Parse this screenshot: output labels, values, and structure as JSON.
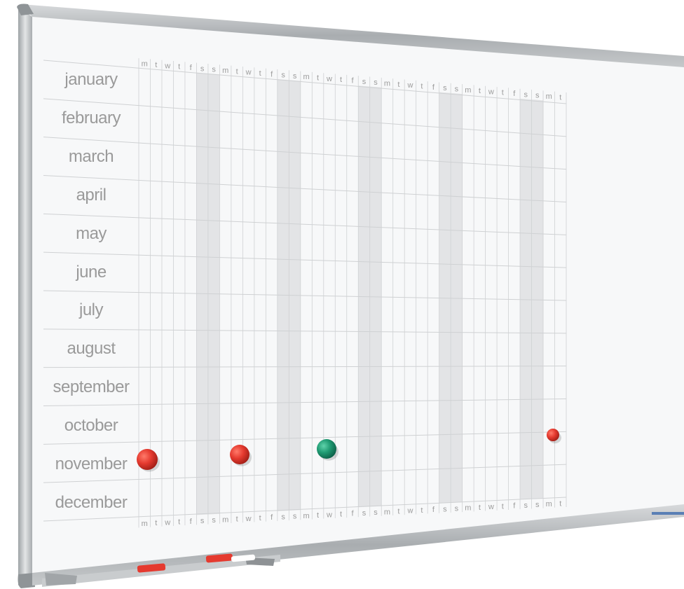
{
  "board": {
    "type": "year-planner whiteboard",
    "months": [
      "january",
      "february",
      "march",
      "april",
      "may",
      "june",
      "july",
      "august",
      "september",
      "october",
      "november",
      "december"
    ],
    "weekday_header": [
      "m",
      "t",
      "w",
      "t",
      "f",
      "s",
      "s",
      "m",
      "t",
      "w",
      "t",
      "f",
      "s",
      "s",
      "m",
      "t",
      "w",
      "t",
      "f",
      "s",
      "s",
      "m",
      "t",
      "w",
      "t",
      "f",
      "s",
      "s",
      "m",
      "t",
      "w",
      "t",
      "f",
      "s",
      "s",
      "m",
      "t"
    ],
    "magnets": [
      {
        "name": "red-magnet-1",
        "color": "#e53a2f"
      },
      {
        "name": "red-magnet-2",
        "color": "#e53a2f"
      },
      {
        "name": "green-magnet",
        "color": "#1f9a72"
      },
      {
        "name": "red-magnet-small",
        "color": "#e53a2f"
      }
    ],
    "colors": {
      "frame": "#b9bdbf",
      "weekend_shade": "#e3e4e6",
      "grid_line": "#cfd1d3",
      "text": "#9a9a9a",
      "magnet_red": "#e53a2f",
      "magnet_green": "#1f9a72"
    }
  }
}
